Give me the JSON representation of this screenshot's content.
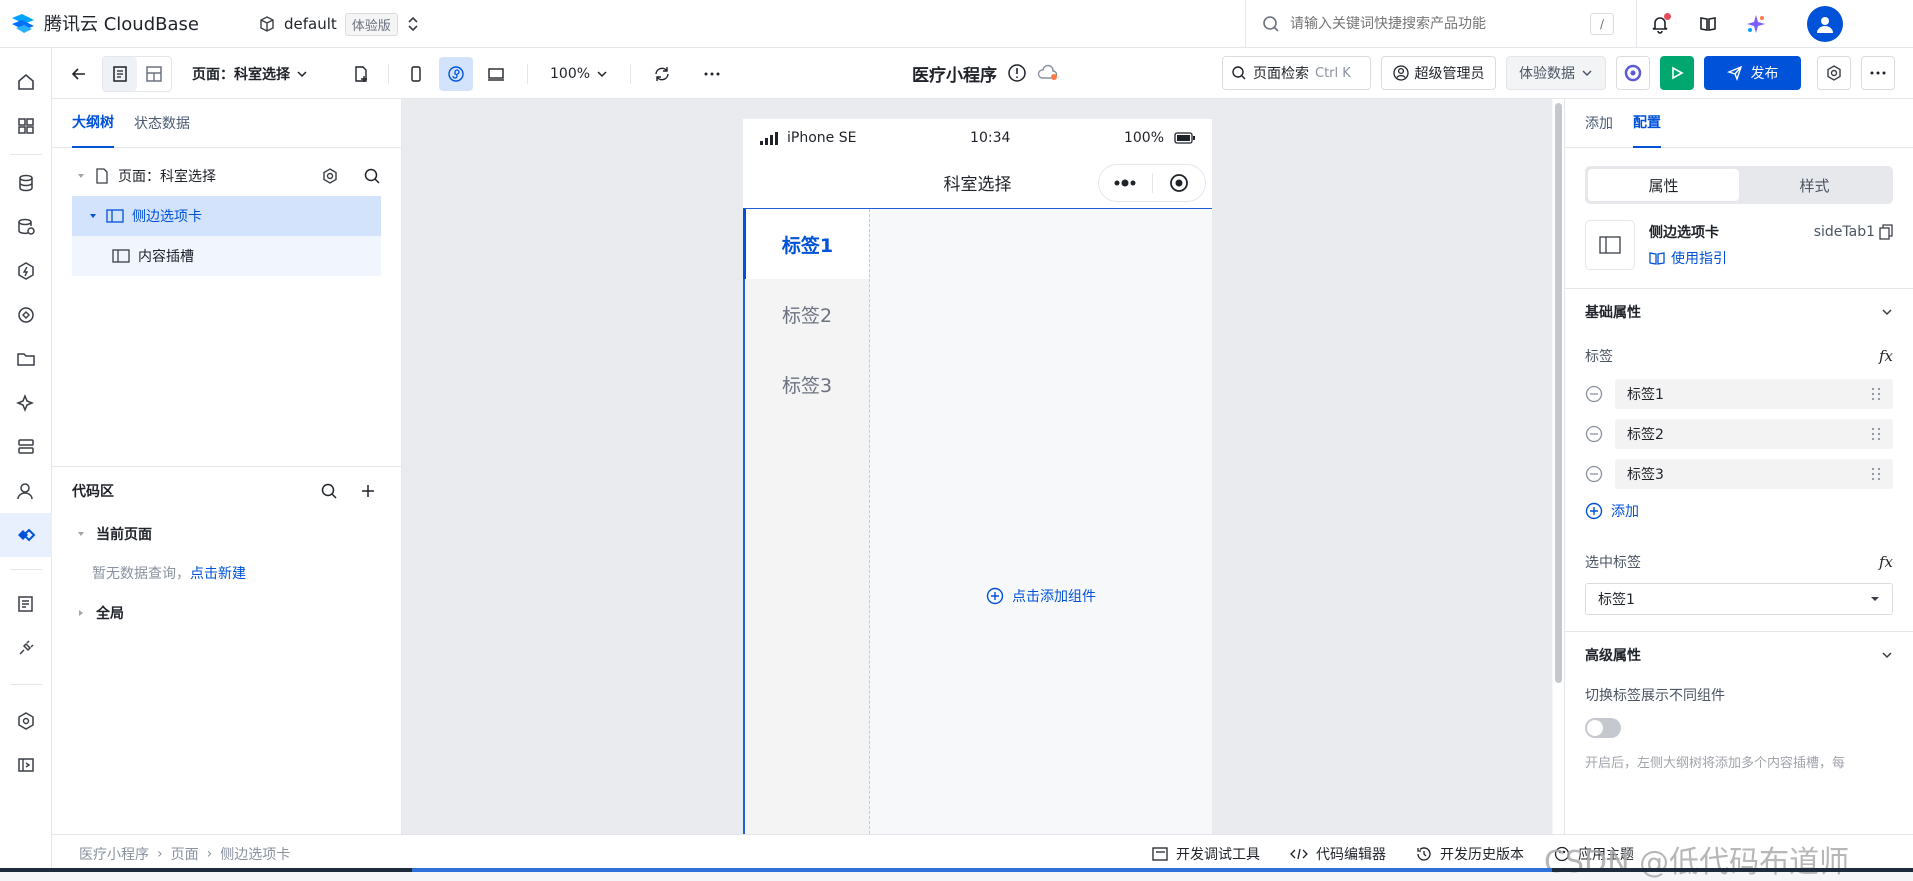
{
  "topbar": {
    "brand": "腾讯云 CloudBase",
    "env_name": "default",
    "env_badge": "体验版",
    "search_placeholder": "请输入关键词快捷搜索产品功能",
    "search_shortcut": "/"
  },
  "toolbar": {
    "page_label": "页面：科室选择",
    "zoom": "100%",
    "app_title": "医疗小程序",
    "page_search": "页面检索",
    "page_search_shortcut": "Ctrl K",
    "admin": "超级管理员",
    "data_mode": "体验数据",
    "publish": "发布"
  },
  "left_panel": {
    "tabs": [
      "大纲树",
      "状态数据"
    ],
    "tree": {
      "page": "页面：科室选择",
      "items": [
        "侧边选项卡",
        "内容插槽"
      ]
    },
    "code": {
      "title": "代码区",
      "current_page": "当前页面",
      "empty_text": "暂无数据查询，",
      "create_link": "点击新建",
      "global": "全局"
    }
  },
  "phone": {
    "carrier": "iPhone SE",
    "time": "10:34",
    "battery": "100%",
    "nav_title": "科室选择",
    "tabs": [
      "标签1",
      "标签2",
      "标签3"
    ],
    "add_component": "点击添加组件"
  },
  "right_panel": {
    "tabs": [
      "添加",
      "配置"
    ],
    "seg": [
      "属性",
      "样式"
    ],
    "component_name": "侧边选项卡",
    "component_id": "sideTab1",
    "guide": "使用指引",
    "basic_title": "基础属性",
    "tags_label": "标签",
    "tags": [
      "标签1",
      "标签2",
      "标签3"
    ],
    "add_label": "添加",
    "selected_label": "选中标签",
    "selected_value": "标签1",
    "advanced_title": "高级属性",
    "switch_label": "切换标签展示不同组件",
    "hint": "开启后，左侧大纲树将添加多个内容插槽，每",
    "fx": "fx"
  },
  "statusbar": {
    "breadcrumb": [
      "医疗小程序",
      "页面",
      "侧边选项卡"
    ],
    "tools": [
      "开发调试工具",
      "代码编辑器",
      "开发历史版本",
      "应用主题"
    ],
    "watermark": "CSDN @低代码布道师"
  }
}
